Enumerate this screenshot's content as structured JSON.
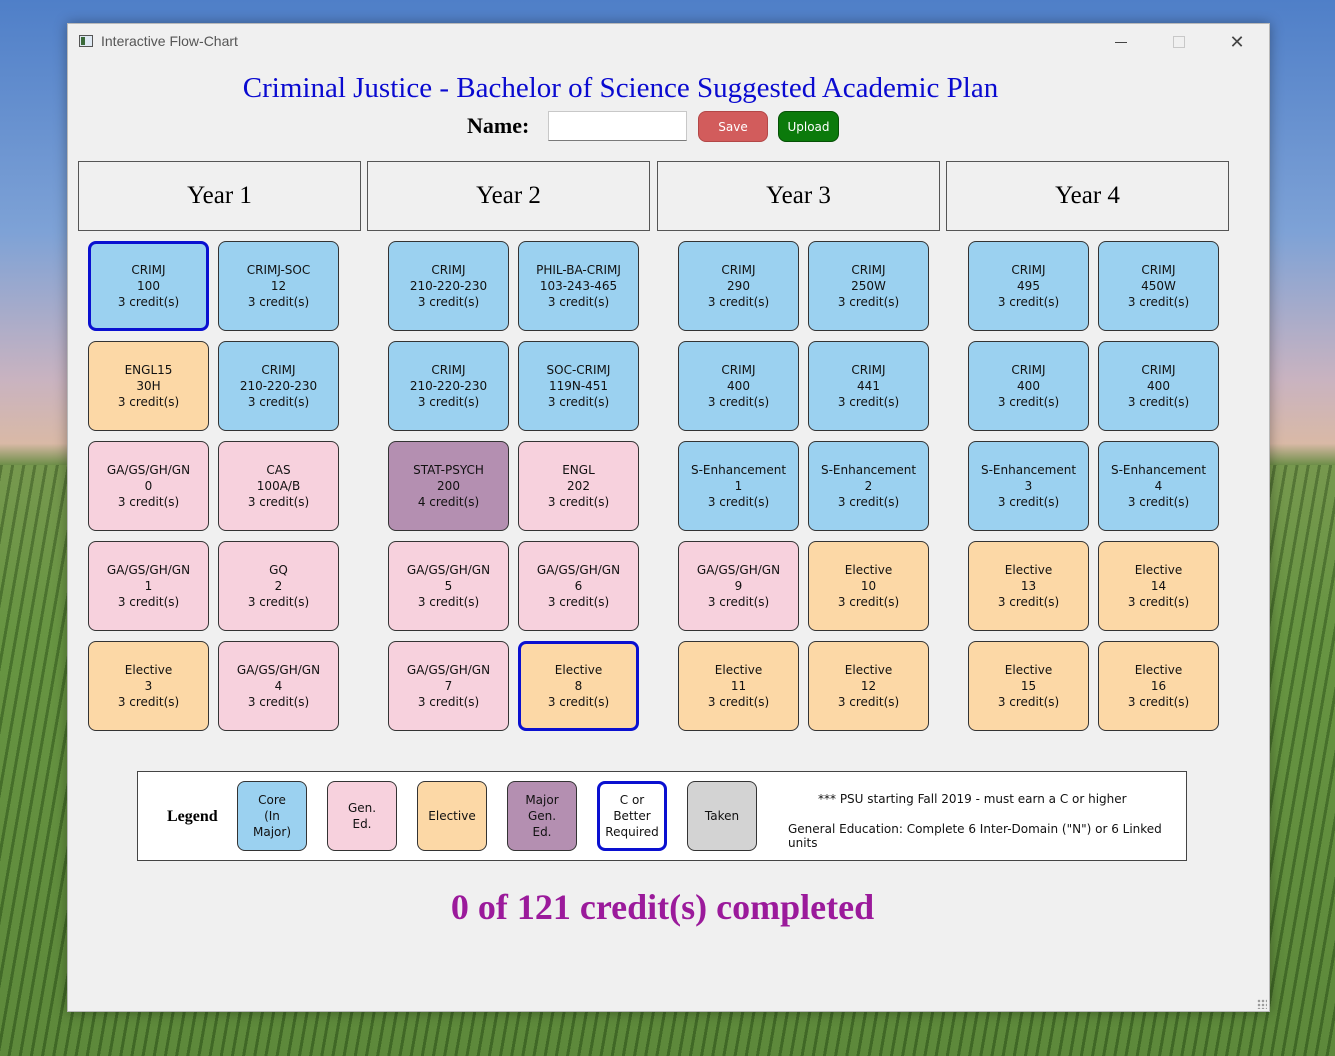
{
  "window": {
    "title": "Interactive Flow-Chart"
  },
  "header": {
    "title": "Criminal Justice - Bachelor of Science Suggested Academic Plan",
    "name_label": "Name:",
    "name_value": "",
    "save_label": "Save",
    "upload_label": "Upload"
  },
  "years": [
    "Year 1",
    "Year 2",
    "Year 3",
    "Year 4"
  ],
  "courses": [
    {
      "lines": [
        "CRIMJ",
        "100",
        "3 credit(s)"
      ],
      "type": "core",
      "c_or_better": true
    },
    {
      "lines": [
        "CRIMJ-SOC",
        "12",
        "3 credit(s)"
      ],
      "type": "core",
      "c_or_better": false
    },
    {
      "lines": [
        "ENGL15",
        "30H",
        "3 credit(s)"
      ],
      "type": "elective",
      "c_or_better": false
    },
    {
      "lines": [
        "CRIMJ",
        "210-220-230",
        "3 credit(s)"
      ],
      "type": "core",
      "c_or_better": false
    },
    {
      "lines": [
        "GA/GS/GH/GN",
        "0",
        "3 credit(s)"
      ],
      "type": "gened",
      "c_or_better": false
    },
    {
      "lines": [
        "CAS",
        "100A/B",
        "3 credit(s)"
      ],
      "type": "gened",
      "c_or_better": false
    },
    {
      "lines": [
        "GA/GS/GH/GN",
        "1",
        "3 credit(s)"
      ],
      "type": "gened",
      "c_or_better": false
    },
    {
      "lines": [
        "GQ",
        "2",
        "3 credit(s)"
      ],
      "type": "gened",
      "c_or_better": false
    },
    {
      "lines": [
        "Elective",
        "3",
        "3 credit(s)"
      ],
      "type": "elective",
      "c_or_better": false
    },
    {
      "lines": [
        "GA/GS/GH/GN",
        "4",
        "3 credit(s)"
      ],
      "type": "gened",
      "c_or_better": false
    },
    {
      "lines": [
        "CRIMJ",
        "210-220-230",
        "3 credit(s)"
      ],
      "type": "core",
      "c_or_better": false
    },
    {
      "lines": [
        "PHIL-BA-CRIMJ",
        "103-243-465",
        "3 credit(s)"
      ],
      "type": "core",
      "c_or_better": false
    },
    {
      "lines": [
        "CRIMJ",
        "210-220-230",
        "3 credit(s)"
      ],
      "type": "core",
      "c_or_better": false
    },
    {
      "lines": [
        "SOC-CRIMJ",
        "119N-451",
        "3 credit(s)"
      ],
      "type": "core",
      "c_or_better": false
    },
    {
      "lines": [
        "STAT-PSYCH",
        "200",
        "4 credit(s)"
      ],
      "type": "major-gened",
      "c_or_better": false
    },
    {
      "lines": [
        "ENGL",
        "202",
        "3 credit(s)"
      ],
      "type": "gened",
      "c_or_better": false
    },
    {
      "lines": [
        "GA/GS/GH/GN",
        "5",
        "3 credit(s)"
      ],
      "type": "gened",
      "c_or_better": false
    },
    {
      "lines": [
        "GA/GS/GH/GN",
        "6",
        "3 credit(s)"
      ],
      "type": "gened",
      "c_or_better": false
    },
    {
      "lines": [
        "GA/GS/GH/GN",
        "7",
        "3 credit(s)"
      ],
      "type": "gened",
      "c_or_better": false
    },
    {
      "lines": [
        "Elective",
        "8",
        "3 credit(s)"
      ],
      "type": "elective",
      "c_or_better": true
    },
    {
      "lines": [
        "CRIMJ",
        "290",
        "3 credit(s)"
      ],
      "type": "core",
      "c_or_better": false
    },
    {
      "lines": [
        "CRIMJ",
        "250W",
        "3 credit(s)"
      ],
      "type": "core",
      "c_or_better": false
    },
    {
      "lines": [
        "CRIMJ",
        "400",
        "3 credit(s)"
      ],
      "type": "core",
      "c_or_better": false
    },
    {
      "lines": [
        "CRIMJ",
        "441",
        "3 credit(s)"
      ],
      "type": "core",
      "c_or_better": false
    },
    {
      "lines": [
        "S-Enhancement",
        "1",
        "3 credit(s)"
      ],
      "type": "core",
      "c_or_better": false
    },
    {
      "lines": [
        "S-Enhancement",
        "2",
        "3 credit(s)"
      ],
      "type": "core",
      "c_or_better": false
    },
    {
      "lines": [
        "GA/GS/GH/GN",
        "9",
        "3 credit(s)"
      ],
      "type": "gened",
      "c_or_better": false
    },
    {
      "lines": [
        "Elective",
        "10",
        "3 credit(s)"
      ],
      "type": "elective",
      "c_or_better": false
    },
    {
      "lines": [
        "Elective",
        "11",
        "3 credit(s)"
      ],
      "type": "elective",
      "c_or_better": false
    },
    {
      "lines": [
        "Elective",
        "12",
        "3 credit(s)"
      ],
      "type": "elective",
      "c_or_better": false
    },
    {
      "lines": [
        "CRIMJ",
        "495",
        "3 credit(s)"
      ],
      "type": "core",
      "c_or_better": false
    },
    {
      "lines": [
        "CRIMJ",
        "450W",
        "3 credit(s)"
      ],
      "type": "core",
      "c_or_better": false
    },
    {
      "lines": [
        "CRIMJ",
        "400",
        "3 credit(s)"
      ],
      "type": "core",
      "c_or_better": false
    },
    {
      "lines": [
        "CRIMJ",
        "400",
        "3 credit(s)"
      ],
      "type": "core",
      "c_or_better": false
    },
    {
      "lines": [
        "S-Enhancement",
        "3",
        "3 credit(s)"
      ],
      "type": "core",
      "c_or_better": false
    },
    {
      "lines": [
        "S-Enhancement",
        "4",
        "3 credit(s)"
      ],
      "type": "core",
      "c_or_better": false
    },
    {
      "lines": [
        "Elective",
        "13",
        "3 credit(s)"
      ],
      "type": "elective",
      "c_or_better": false
    },
    {
      "lines": [
        "Elective",
        "14",
        "3 credit(s)"
      ],
      "type": "elective",
      "c_or_better": false
    },
    {
      "lines": [
        "Elective",
        "15",
        "3 credit(s)"
      ],
      "type": "elective",
      "c_or_better": false
    },
    {
      "lines": [
        "Elective",
        "16",
        "3 credit(s)"
      ],
      "type": "elective",
      "c_or_better": false
    }
  ],
  "legend": {
    "title": "Legend",
    "items": [
      {
        "lines": [
          "Core",
          "(In",
          "Major)"
        ],
        "color": "#9bd1f0",
        "border": "#333333"
      },
      {
        "lines": [
          "Gen.",
          "Ed."
        ],
        "color": "#f7d1dd",
        "border": "#333333"
      },
      {
        "lines": [
          "Elective"
        ],
        "color": "#fcd8a6",
        "border": "#333333"
      },
      {
        "lines": [
          "Major",
          "Gen.",
          "Ed."
        ],
        "color": "#b48fb1",
        "border": "#333333"
      },
      {
        "lines": [
          "C or",
          "Better",
          "Required"
        ],
        "color": "#ffffff",
        "border": "#0a10d0"
      },
      {
        "lines": [
          "Taken"
        ],
        "color": "#d3d3d3",
        "border": "#333333"
      }
    ],
    "note1": "*** PSU starting Fall 2019 - must earn a C or higher",
    "note2": "General Education: Complete 6 Inter-Domain (\"N\") or 6 Linked units"
  },
  "credits_summary": "0 of 121 credit(s) completed",
  "colors": {
    "title_blue": "#0a0ad0",
    "credits_purple": "#9b1a9b",
    "save_red": "#d25c5c",
    "upload_green": "#0b7a0b"
  }
}
